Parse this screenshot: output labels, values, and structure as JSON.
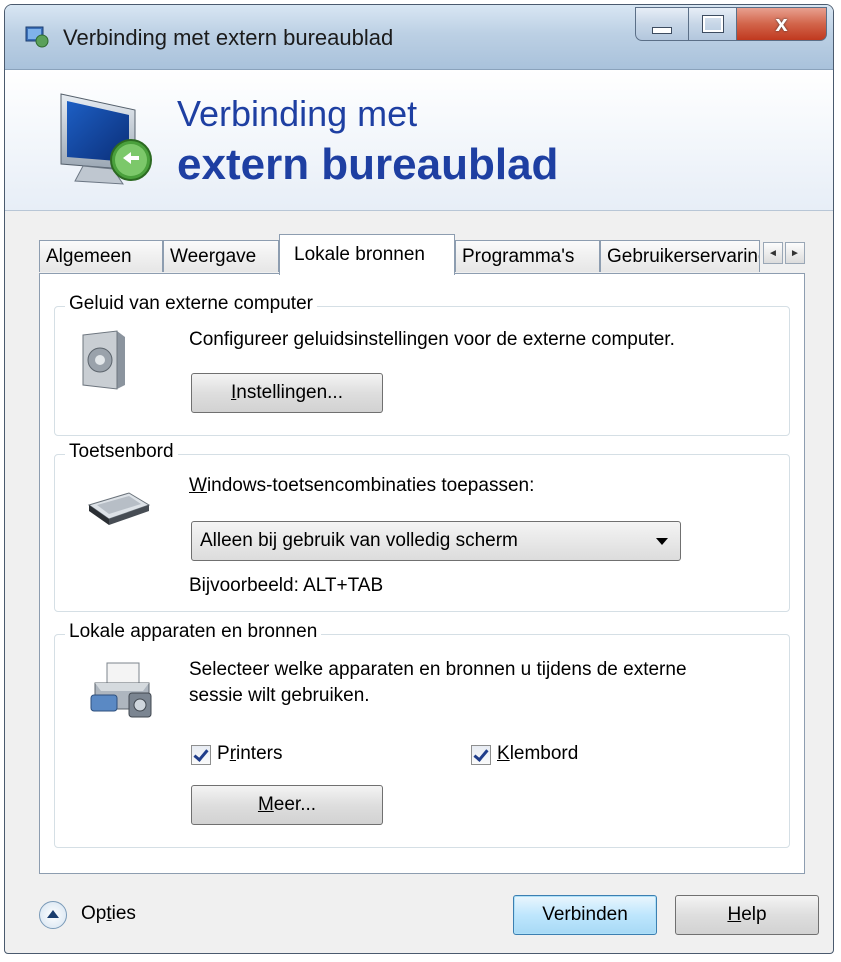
{
  "window": {
    "title": "Verbinding met extern bureaublad",
    "close_glyph": "x",
    "minimize_icon": "minimize-icon",
    "maximize_icon": "maximize-icon",
    "close_icon": "close-icon"
  },
  "banner": {
    "line1": "Verbinding met",
    "line2": "extern bureaublad",
    "icon": "remote-desktop-monitor-icon"
  },
  "tabs": [
    {
      "label": "Algemeen"
    },
    {
      "label": "Weergave"
    },
    {
      "label": "Lokale bronnen",
      "active": true
    },
    {
      "label": "Programma's"
    },
    {
      "label": "Gebruikerservaring"
    }
  ],
  "tab_scroll": {
    "left": "◄",
    "right": "►"
  },
  "sound": {
    "title": "Geluid van externe computer",
    "description": "Configureer geluidsinstellingen voor de externe computer.",
    "button": {
      "accel": "I",
      "rest": "nstellingen..."
    },
    "icon": "speaker-icon"
  },
  "keyboard": {
    "title": "Toetsenbord",
    "label": {
      "accel": "W",
      "rest": "indows-toetsencombinaties toepassen:"
    },
    "selected": "Alleen bij gebruik van volledig scherm",
    "example": "Bijvoorbeeld: ALT+TAB",
    "icon": "keyboard-icon"
  },
  "devices": {
    "title": "Lokale apparaten en bronnen",
    "description_line1": "Selecteer welke apparaten en bronnen u tijdens de externe",
    "description_line2": "sessie wilt gebruiken.",
    "printers": {
      "pre": "P",
      "accel": "r",
      "rest": "inters",
      "checked": true
    },
    "clipboard": {
      "accel": "K",
      "rest": "lembord",
      "checked": true
    },
    "more_button": {
      "accel": "M",
      "rest": "eer..."
    },
    "icon": "devices-icon"
  },
  "footer": {
    "options": {
      "pre": "Op",
      "accel": "t",
      "rest": "ies"
    },
    "connect": "Verbinden",
    "help": {
      "accel": "H",
      "rest": "elp"
    }
  },
  "colors": {
    "banner_text": "#1e3fa2",
    "default_button": "#3c7fb1"
  }
}
